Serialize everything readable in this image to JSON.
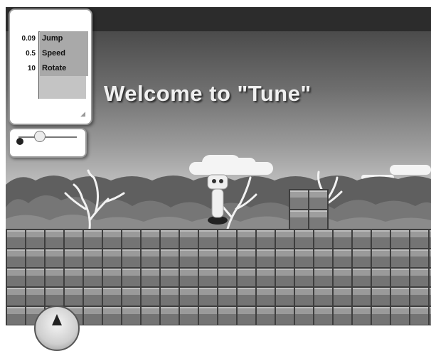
{
  "game": {
    "title": "Welcome to \"Tune\""
  },
  "parameters": [
    {
      "value": "0.09",
      "name": "Jump"
    },
    {
      "value": "0.5",
      "name": "Speed"
    },
    {
      "value": "10",
      "name": "Rotate"
    }
  ],
  "slider": {
    "level": 0.36
  },
  "icons": {
    "resize": "resize-grip-icon",
    "compass": "compass-icon",
    "character": "robot-character"
  },
  "colors": {
    "sky_top": "#4b4b4b",
    "sky_bottom": "#c9c9c9",
    "blocks": "#6a6a6a",
    "list_background": "#a9a9a9"
  }
}
